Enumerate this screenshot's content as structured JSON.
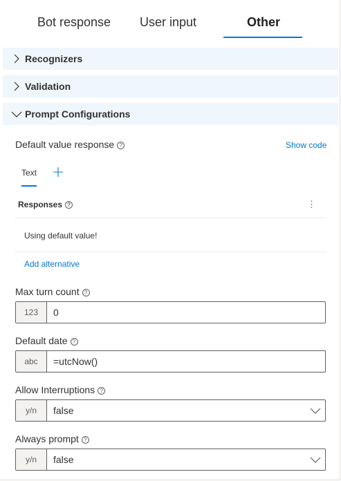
{
  "tabs": [
    {
      "label": "Bot response",
      "active": false
    },
    {
      "label": "User input",
      "active": false
    },
    {
      "label": "Other",
      "active": true
    }
  ],
  "sections": [
    {
      "label": "Recognizers",
      "expanded": false
    },
    {
      "label": "Validation",
      "expanded": false
    },
    {
      "label": "Prompt Configurations",
      "expanded": true
    }
  ],
  "default_value_response": {
    "label": "Default value response",
    "show_code": "Show code",
    "text_tab": "Text",
    "responses_label": "Responses",
    "items": [
      "Using default value!"
    ],
    "add_alternative": "Add alternative"
  },
  "fields": {
    "max_turn_count": {
      "label": "Max turn count",
      "prefix": "123",
      "value": "0"
    },
    "default_date": {
      "label": "Default date",
      "prefix": "abc",
      "value": "=utcNow()"
    },
    "allow_interruptions": {
      "label": "Allow Interruptions",
      "prefix": "y/n",
      "value": "false"
    },
    "always_prompt": {
      "label": "Always prompt",
      "prefix": "y/n",
      "value": "false"
    }
  },
  "help_glyph": "?",
  "more_glyph": "⋮",
  "colors": {
    "accent": "#0078d4",
    "section_bg": "#eff6fc",
    "prefix_bg": "#f3f2f1"
  }
}
